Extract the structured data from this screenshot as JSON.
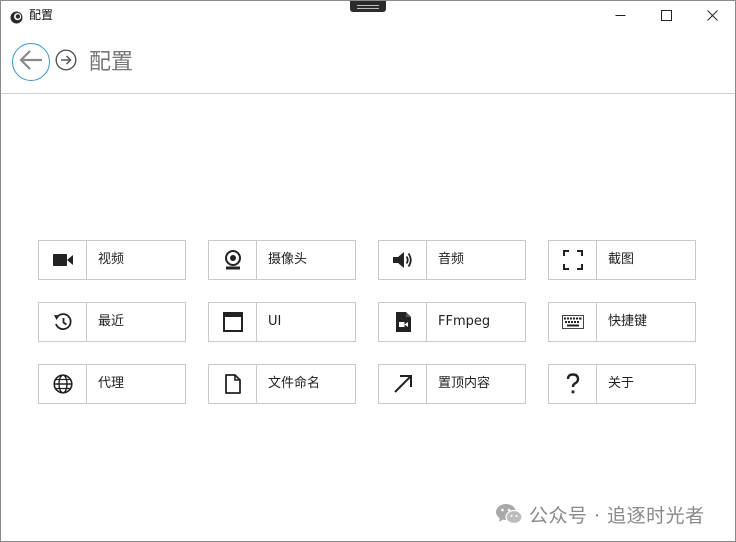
{
  "window": {
    "title": "配置",
    "controls": [
      "minimize-icon",
      "maximize-icon",
      "close-icon"
    ]
  },
  "header": {
    "back_icon": "arrow-left-icon",
    "forward_icon": "arrow-right-circle-icon",
    "title": "配置"
  },
  "tiles": [
    {
      "label": "视频",
      "icon": "video-camera-icon"
    },
    {
      "label": "摄像头",
      "icon": "webcam-icon"
    },
    {
      "label": "音频",
      "icon": "speaker-icon"
    },
    {
      "label": "截图",
      "icon": "screenshot-frame-icon"
    },
    {
      "label": "最近",
      "icon": "history-icon"
    },
    {
      "label": "UI",
      "icon": "window-icon"
    },
    {
      "label": "FFmpeg",
      "icon": "video-file-icon"
    },
    {
      "label": "快捷键",
      "icon": "keyboard-icon"
    },
    {
      "label": "代理",
      "icon": "globe-icon"
    },
    {
      "label": "文件命名",
      "icon": "document-icon"
    },
    {
      "label": "置顶内容",
      "icon": "arrow-up-right-icon"
    },
    {
      "label": "关于",
      "icon": "question-mark-icon"
    }
  ],
  "watermark": {
    "text": "公众号 · 追逐时光者",
    "icon": "wechat-icon"
  }
}
